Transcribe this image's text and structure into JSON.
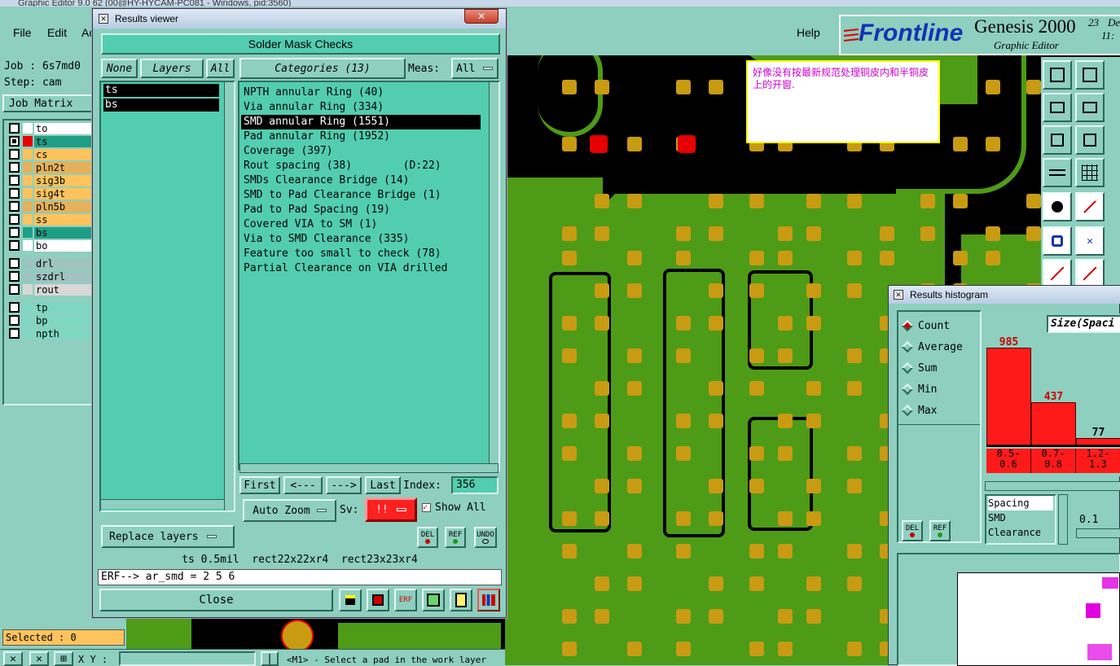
{
  "app": {
    "title": "Graphic Editor 9.0 62 (00@HY-HYCAM-PC081 - Windows, pid:3560)",
    "menu": [
      "File",
      "Edit",
      "Ac"
    ],
    "help": "Help",
    "brand": "Frontline",
    "product": "Genesis 2000",
    "product_sub": "Graphic Editor",
    "date_day": "23",
    "date_mon": "De",
    "time": "11:"
  },
  "left": {
    "job": "Job : 6s7md0",
    "step": "Step: cam",
    "job_matrix": "Job Matrix",
    "selected": "Selected : 0",
    "xy_label": "X Y :",
    "status_msg": "<M1> - Select a pad in the work layer",
    "layers": [
      {
        "name": "to",
        "color": "#ffffff",
        "active": false
      },
      {
        "name": "ts",
        "color": "#1f9e86",
        "active": true
      },
      {
        "name": "cs",
        "color": "#ffc35c",
        "active": false
      },
      {
        "name": "pln2t",
        "color": "#e6b15a",
        "active": false
      },
      {
        "name": "sig3b",
        "color": "#ffc35c",
        "active": false
      },
      {
        "name": "sig4t",
        "color": "#ffc35c",
        "active": false
      },
      {
        "name": "pln5b",
        "color": "#e6b15a",
        "active": false
      },
      {
        "name": "ss",
        "color": "#ffc35c",
        "active": false
      },
      {
        "name": "bs",
        "color": "#1f9e86",
        "active": false
      },
      {
        "name": "bo",
        "color": "#ffffff",
        "active": false
      }
    ],
    "drill_layers": [
      {
        "name": "drl",
        "color": "#9ec3c0"
      },
      {
        "name": "szdrl",
        "color": "#9ec3c0"
      },
      {
        "name": "rout",
        "color": "#d8d8d8"
      }
    ],
    "other_layers": [
      {
        "name": "tp",
        "color": "#7fd6c3"
      },
      {
        "name": "bp",
        "color": "#7fd6c3"
      },
      {
        "name": "npth",
        "color": "#7fd6c3"
      }
    ]
  },
  "results_viewer": {
    "title": "Results viewer",
    "header": "Solder Mask Checks",
    "none_btn": "None",
    "layers_btn": "Layers",
    "all_btn": "All",
    "layer_list": [
      "ts",
      "bs"
    ],
    "categories_btn": "Categories (13)",
    "meas_label": "Meas:",
    "meas_value": "All",
    "categories": [
      "NPTH annular Ring (40)",
      "Via annular Ring (334)",
      "SMD annular Ring (1551)",
      "Pad annular Ring (1952)",
      "Coverage (397)",
      "Rout spacing (38)        (D:22)",
      "SMDs Clearance Bridge (14)",
      "SMD to Pad Clearance Bridge (1)",
      "Pad to Pad Spacing (19)",
      "Covered VIA to SM (1)",
      "Via to SMD Clearance (335)",
      "Feature too small to check (78)",
      "Partial Clearance on VIA drilled"
    ],
    "selected_category_index": 2,
    "first": "First",
    "prev": "<---",
    "next": "--->",
    "last": "Last",
    "index_label": "Index:",
    "index_value": "356",
    "replace_layers": "Replace layers",
    "auto_zoom": "Auto Zoom",
    "sv_label": "Sv:",
    "sv_value": "!!",
    "show_all": "Show All",
    "del": "DEL",
    "ref": "REF",
    "undo": "UNDO",
    "info_line": "ts 0.5mil  rect22x22xr4  rect23x23xr4",
    "erf_line": "ERF--> ar_smd = 2 5 6",
    "close": "Close",
    "accent_red": "#ff2020"
  },
  "note": {
    "text": "好像没有按最新规范处理铜皮内和半铜皮上的开窗."
  },
  "histogram": {
    "title": "Results histogram",
    "modes": [
      "Count",
      "Average",
      "Sum",
      "Min",
      "Max"
    ],
    "selected_mode": 0,
    "size_label": "Size(Spaci",
    "del": "DEL",
    "ref": "REF",
    "metric_list": [
      "Spacing",
      "SMD",
      "Clearance"
    ],
    "slider_value": "0.1"
  },
  "chart_data": {
    "type": "bar",
    "categories": [
      "0.5-0.6",
      "0.7-0.8",
      "1.2-1.3"
    ],
    "tick_labels_top": [
      "0.5-",
      "0.7-",
      "1.2-"
    ],
    "tick_labels_bottom": [
      "0.6",
      "0.8",
      "1.3"
    ],
    "values": [
      985,
      437,
      77
    ],
    "value_labels": [
      "985",
      "437",
      "77"
    ],
    "ylim": [
      0,
      1100
    ],
    "bar_color": "#ff1a1a"
  }
}
